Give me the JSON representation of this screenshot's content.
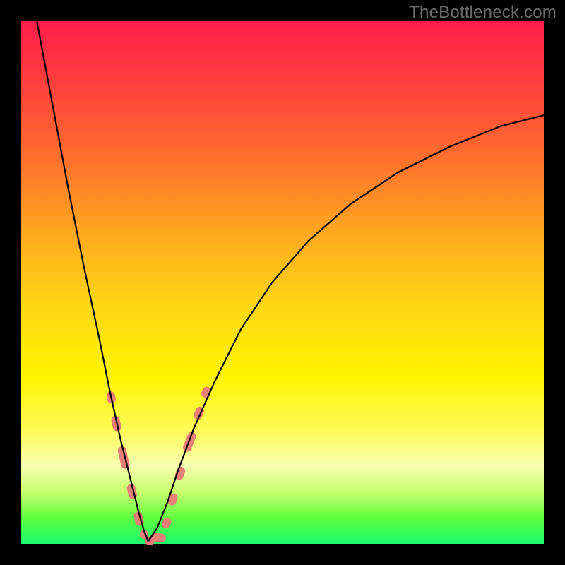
{
  "watermark": "TheBottleneck.com",
  "colors": {
    "frame": "#000000",
    "curve": "#000000",
    "bead": "#e98077",
    "gradient_top": "#ff1d4a",
    "gradient_bottom": "#1afc70"
  },
  "chart_data": {
    "type": "line",
    "title": "",
    "xlabel": "",
    "ylabel": "",
    "xlim": [
      0,
      100
    ],
    "ylim": [
      0,
      100
    ],
    "grid": false,
    "note": "Bottleneck-style V-curve. No axis ticks or numeric labels are shown; x/y values below are estimated from pixel positions on a 0–100 scale covering the plot area (origin at bottom-left of gradient region). Minimum (≈0) is near x≈24.",
    "series": [
      {
        "name": "left-branch",
        "x": [
          3.0,
          6.0,
          9.0,
          12.0,
          15.0,
          17.0,
          19.0,
          21.0,
          22.5,
          23.5,
          24.3
        ],
        "y": [
          100.0,
          84.0,
          68.0,
          53.0,
          39.0,
          29.0,
          20.0,
          12.0,
          6.0,
          2.5,
          0.5
        ]
      },
      {
        "name": "right-branch",
        "x": [
          24.3,
          26.0,
          28.0,
          30.0,
          33.0,
          37.0,
          42.0,
          48.0,
          55.0,
          63.0,
          72.0,
          82.0,
          92.0,
          100.0
        ],
        "y": [
          0.5,
          3.0,
          8.0,
          14.0,
          22.0,
          31.0,
          41.0,
          50.0,
          58.0,
          65.0,
          71.0,
          76.0,
          80.0,
          82.0
        ]
      }
    ],
    "beads": {
      "note": "Salmon rounded dash markers along lower portion of both branches; coordinates estimated on same 0–100 scale.",
      "points": [
        {
          "x": 17.2,
          "y": 28.0,
          "len": 2.2,
          "branch": "left"
        },
        {
          "x": 18.2,
          "y": 23.0,
          "len": 2.8,
          "branch": "left"
        },
        {
          "x": 19.6,
          "y": 16.5,
          "len": 4.2,
          "branch": "left"
        },
        {
          "x": 21.2,
          "y": 10.0,
          "len": 2.8,
          "branch": "left"
        },
        {
          "x": 22.5,
          "y": 4.8,
          "len": 2.6,
          "branch": "left"
        },
        {
          "x": 23.5,
          "y": 1.8,
          "len": 1.6,
          "branch": "left"
        },
        {
          "x": 24.6,
          "y": 0.6,
          "len": 1.8,
          "branch": "bottom"
        },
        {
          "x": 26.2,
          "y": 1.2,
          "len": 2.8,
          "branch": "bottom"
        },
        {
          "x": 27.8,
          "y": 4.0,
          "len": 2.0,
          "branch": "right"
        },
        {
          "x": 29.0,
          "y": 8.5,
          "len": 2.2,
          "branch": "right"
        },
        {
          "x": 30.4,
          "y": 13.5,
          "len": 2.4,
          "branch": "right"
        },
        {
          "x": 32.2,
          "y": 19.5,
          "len": 3.8,
          "branch": "right"
        },
        {
          "x": 34.0,
          "y": 25.0,
          "len": 2.4,
          "branch": "right"
        },
        {
          "x": 35.4,
          "y": 29.0,
          "len": 2.0,
          "branch": "right"
        }
      ]
    }
  }
}
